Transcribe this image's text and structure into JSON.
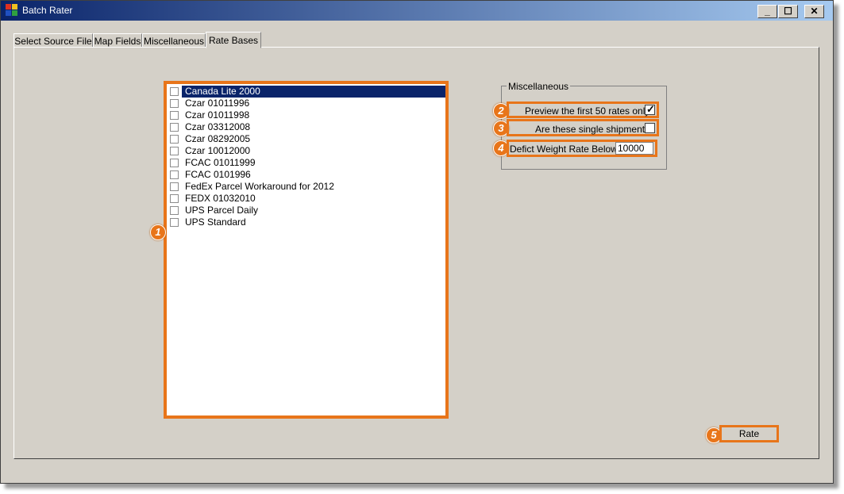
{
  "window": {
    "title": "Batch Rater"
  },
  "title_controls": {
    "minimize": "_",
    "maximize": "☐",
    "close": "✕"
  },
  "tabs": [
    {
      "label": "Select Source File"
    },
    {
      "label": "Map Fields"
    },
    {
      "label": "Miscellaneous"
    },
    {
      "label": "Rate Bases",
      "active": true
    }
  ],
  "rate_bases": {
    "items": [
      {
        "label": "Canada Lite 2000",
        "checked": false,
        "selected": true
      },
      {
        "label": "Czar 01011996",
        "checked": false
      },
      {
        "label": "Czar 01011998",
        "checked": false
      },
      {
        "label": "Czar 03312008",
        "checked": false
      },
      {
        "label": "Czar 08292005",
        "checked": false
      },
      {
        "label": "Czar 10012000",
        "checked": false
      },
      {
        "label": "FCAC 01011999",
        "checked": false
      },
      {
        "label": "FCAC 0101996",
        "checked": false
      },
      {
        "label": "FedEx Parcel Workaround for 2012",
        "checked": false
      },
      {
        "label": "FEDX 01032010",
        "checked": false
      },
      {
        "label": "UPS Parcel Daily",
        "checked": false
      },
      {
        "label": "UPS Standard",
        "checked": false
      }
    ]
  },
  "miscellaneous": {
    "title": "Miscellaneous",
    "preview_label": "Preview the first 50 rates only?",
    "preview_checked": true,
    "single_shipments_label": "Are these single shipments?",
    "single_shipments_checked": false,
    "deficit_label": "Defict Weight Rate Below",
    "deficit_value": "10000"
  },
  "actions": {
    "rate_label": "Rate"
  },
  "callouts": {
    "c1": "1",
    "c2": "2",
    "c3": "3",
    "c4": "4",
    "c5": "5"
  },
  "colors": {
    "accent": "#e8751a",
    "selection": "#0a246a",
    "window_bg": "#d4d0c8"
  }
}
